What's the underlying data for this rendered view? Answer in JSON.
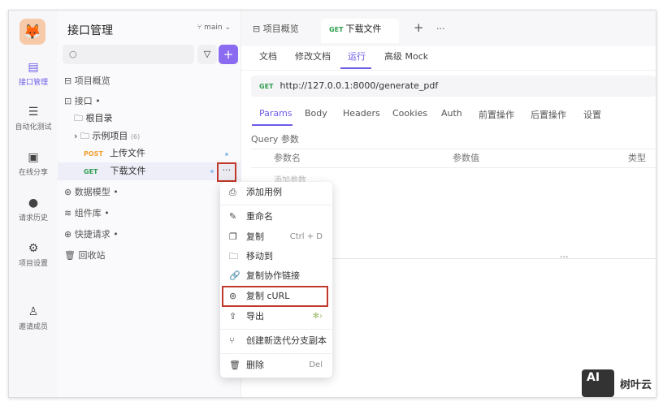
{
  "rail": {
    "items": [
      {
        "label": "接口管理",
        "icon": "api-icon"
      },
      {
        "label": "自动化测试",
        "icon": "automation-icon"
      },
      {
        "label": "在线分享",
        "icon": "share-icon"
      },
      {
        "label": "请求历史",
        "icon": "history-icon"
      },
      {
        "label": "项目设置",
        "icon": "settings-icon"
      },
      {
        "label": "邀请成员",
        "icon": "invite-user-icon"
      }
    ]
  },
  "sidebar": {
    "title": "接口管理",
    "branch": "main",
    "tree": [
      "项目概览",
      "接口",
      "根目录",
      "示例项目",
      "(6)",
      "上传文件",
      "下载文件",
      "数据模型",
      "组件库",
      "快捷请求",
      "回收站"
    ],
    "post": "POST",
    "get": "GET",
    "more": "···"
  },
  "tabs": {
    "items": [
      "项目概览",
      "下载文件"
    ],
    "method": "GET",
    "add": "+",
    "more": "···"
  },
  "subtabs": [
    "文档",
    "修改文档",
    "运行",
    "高级 Mock"
  ],
  "url": {
    "method": "GET",
    "value": "http://127.0.0.1:8000/generate_pdf"
  },
  "ptabs": [
    "Params",
    "Body",
    "Headers",
    "Cookies",
    "Auth",
    "前置操作",
    "后置操作",
    "设置"
  ],
  "query": {
    "label": "Query 参数",
    "headers": [
      "参数名",
      "参数值",
      "类型"
    ],
    "placeholder": "添加参数"
  },
  "menu": {
    "items": [
      {
        "label": "添加用例"
      },
      {
        "label": "重命名"
      },
      {
        "label": "复制",
        "shortcut": "Ctrl + D"
      },
      {
        "label": "移动到"
      },
      {
        "label": "复制协作链接"
      },
      {
        "label": "复制 cURL"
      },
      {
        "label": "导出"
      },
      {
        "label": "创建新迭代分支副本"
      },
      {
        "label": "删除",
        "shortcut": "Del"
      }
    ]
  },
  "watermark": {
    "logo": "AI",
    "text": "树叶云"
  },
  "colors": {
    "accent": "#6c5ce7",
    "get": "#2e9e4e",
    "post": "#f0a030",
    "highlight": "#c0392b"
  }
}
